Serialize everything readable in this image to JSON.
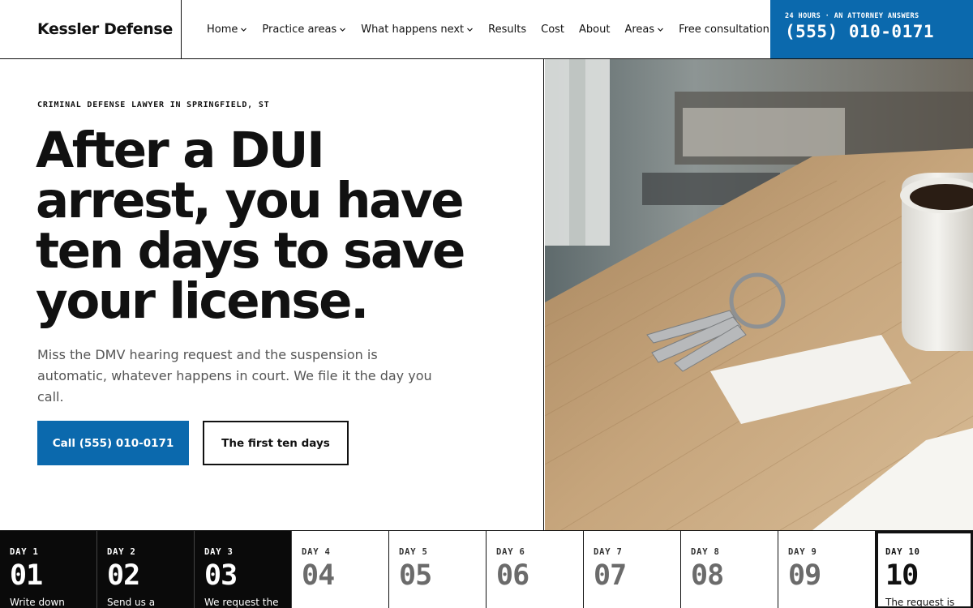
{
  "brand": {
    "name": "Kessler Defense"
  },
  "nav": {
    "items": [
      {
        "label": "Home",
        "dropdown": true
      },
      {
        "label": "Practice areas",
        "dropdown": true
      },
      {
        "label": "What happens next",
        "dropdown": true
      },
      {
        "label": "Results",
        "dropdown": false
      },
      {
        "label": "Cost",
        "dropdown": false
      },
      {
        "label": "About",
        "dropdown": false
      },
      {
        "label": "Areas",
        "dropdown": true
      },
      {
        "label": "Free consultation",
        "dropdown": false
      }
    ]
  },
  "phone": {
    "kicker": "24 HOURS · AN ATTORNEY ANSWERS",
    "number": "(555) 010-0171"
  },
  "hero": {
    "eyebrow": "CRIMINAL DEFENSE LAWYER IN SPRINGFIELD, ST",
    "headline": "After a DUI arrest, you have ten days to save your license.",
    "lede": "Miss the DMV hearing request and the suspension is automatic, whatever happens in court. We file it the day you call.",
    "primary_cta": "Call (555) 010-0171",
    "secondary_cta": "The first ten days"
  },
  "colors": {
    "accent": "#0b69ad",
    "ink": "#111111",
    "dark": "#0a0a0a"
  },
  "timeline": {
    "days": [
      {
        "label": "DAY 1",
        "number": "01",
        "text": "Write down",
        "state": "done"
      },
      {
        "label": "DAY 2",
        "number": "02",
        "text": "Send us a",
        "state": "done"
      },
      {
        "label": "DAY 3",
        "number": "03",
        "text": "We request the",
        "state": "done"
      },
      {
        "label": "DAY 4",
        "number": "04",
        "text": "",
        "state": "future"
      },
      {
        "label": "DAY 5",
        "number": "05",
        "text": "",
        "state": "future"
      },
      {
        "label": "DAY 6",
        "number": "06",
        "text": "",
        "state": "future"
      },
      {
        "label": "DAY 7",
        "number": "07",
        "text": "",
        "state": "future"
      },
      {
        "label": "DAY 8",
        "number": "08",
        "text": "",
        "state": "future"
      },
      {
        "label": "DAY 9",
        "number": "09",
        "text": "",
        "state": "future"
      },
      {
        "label": "DAY 10",
        "number": "10",
        "text": "The request is",
        "state": "current"
      }
    ]
  }
}
